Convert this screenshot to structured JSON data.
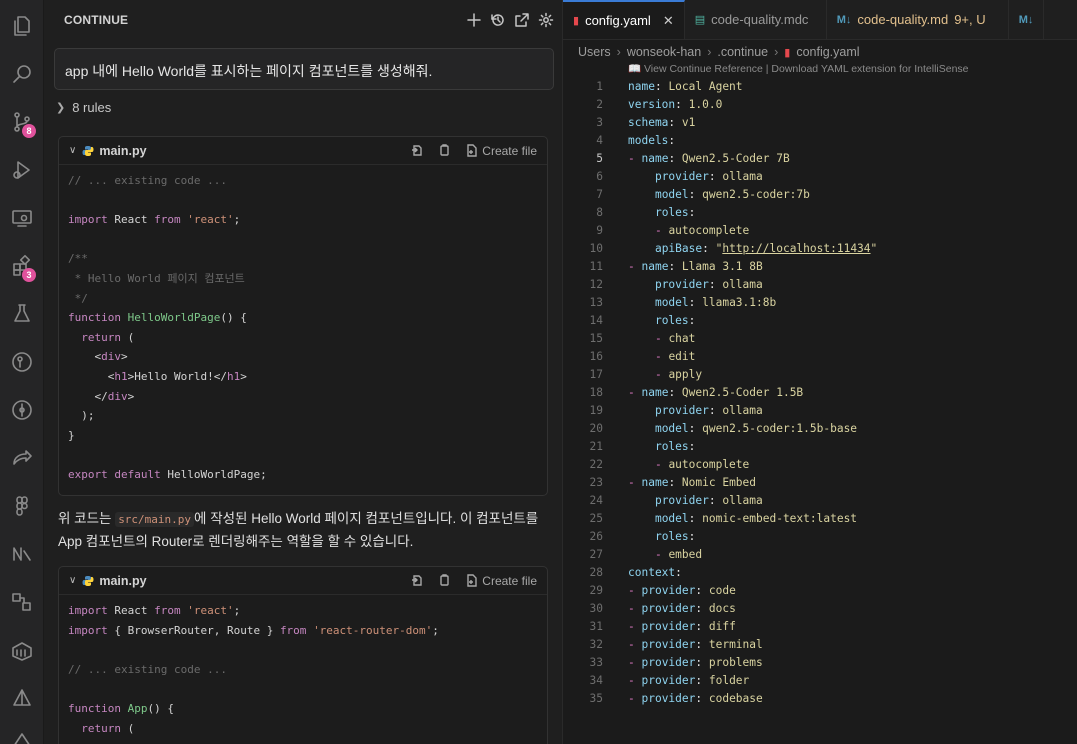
{
  "activity_bar": {
    "items": [
      {
        "name": "explorer-icon",
        "badge": ""
      },
      {
        "name": "search-icon",
        "badge": ""
      },
      {
        "name": "source-control-icon",
        "badge": "8"
      },
      {
        "name": "run-debug-icon",
        "badge": ""
      },
      {
        "name": "remote-explorer-icon",
        "badge": ""
      },
      {
        "name": "extensions-icon",
        "badge": "3"
      },
      {
        "name": "testing-icon",
        "badge": ""
      },
      {
        "name": "gitlens-icon",
        "badge": ""
      },
      {
        "name": "git-graph-icon",
        "badge": ""
      },
      {
        "name": "live-share-icon",
        "badge": ""
      },
      {
        "name": "figma-icon",
        "badge": ""
      },
      {
        "name": "n8n-icon",
        "badge": ""
      },
      {
        "name": "database-icon",
        "badge": ""
      },
      {
        "name": "docker-icon",
        "badge": ""
      },
      {
        "name": "prompt-icon",
        "badge": ""
      },
      {
        "name": "continue-icon",
        "badge": ""
      }
    ]
  },
  "panel": {
    "title": "CONTINUE",
    "prompt": "app 내에 Hello World를 표시하는 페이지 컴포넌트를 생성해줘.",
    "rules_label": "8 rules",
    "code_blocks": [
      {
        "filename": "main.py",
        "create_label": "Create file",
        "lines": [
          "// ... existing code ...",
          "",
          "import React from 'react';",
          "",
          "/**",
          " * Hello World 페이지 컴포넌트",
          " */",
          "function HelloWorldPage() {",
          "  return (",
          "    <div>",
          "      <h1>Hello World!</h1>",
          "    </div>",
          "  );",
          "}",
          "",
          "export default HelloWorldPage;"
        ]
      },
      {
        "filename": "main.py",
        "create_label": "Create file",
        "lines": [
          "import React from 'react';",
          "import { BrowserRouter, Route } from 'react-router-dom';",
          "",
          "// ... existing code ...",
          "",
          "function App() {",
          "  return ("
        ]
      }
    ],
    "explanation_pre": "위 코드는 ",
    "explanation_code": "src/main.py",
    "explanation_post": "에 작성된 Hello World 페이지 컴포넌트입니다. 이 컴포넌트를 App 컴포넌트의 Router로 렌더링해주는 역할을 할 수 있습니다."
  },
  "editor": {
    "tabs": [
      {
        "label": "config.yaml",
        "icon": "!",
        "active": true,
        "status": ""
      },
      {
        "label": "code-quality.mdc",
        "icon": "≡",
        "active": false,
        "status": ""
      },
      {
        "label": "code-quality.md",
        "icon": "M↓",
        "active": false,
        "status": "9+, U"
      },
      {
        "label": "",
        "icon": "M↓",
        "active": false,
        "status": ""
      }
    ],
    "breadcrumb": [
      "Users",
      "wonseok-han",
      ".continue",
      "config.yaml"
    ],
    "hint": "📖 View Continue Reference | Download YAML extension for IntelliSense",
    "current_line": 5,
    "lines": [
      {
        "n": "1",
        "indent": 0,
        "dash": false,
        "key": "name",
        "val": "Local Agent"
      },
      {
        "n": "2",
        "indent": 0,
        "dash": false,
        "key": "version",
        "val": "1.0.0"
      },
      {
        "n": "3",
        "indent": 0,
        "dash": false,
        "key": "schema",
        "val": "v1"
      },
      {
        "n": "4",
        "indent": 0,
        "dash": false,
        "key": "models",
        "val": ""
      },
      {
        "n": "5",
        "indent": 1,
        "dash": true,
        "key": "name",
        "val": "Qwen2.5-Coder 7B"
      },
      {
        "n": "6",
        "indent": 2,
        "dash": false,
        "key": "provider",
        "val": "ollama"
      },
      {
        "n": "7",
        "indent": 2,
        "dash": false,
        "key": "model",
        "val": "qwen2.5-coder:7b"
      },
      {
        "n": "8",
        "indent": 2,
        "dash": false,
        "key": "roles",
        "val": ""
      },
      {
        "n": "9",
        "indent": 3,
        "dash": true,
        "key": "",
        "val": "autocomplete"
      },
      {
        "n": "10",
        "indent": 2,
        "dash": false,
        "key": "apiBase",
        "val": "\"http://localhost:11434\""
      },
      {
        "n": "11",
        "indent": 1,
        "dash": true,
        "key": "name",
        "val": "Llama 3.1 8B"
      },
      {
        "n": "12",
        "indent": 2,
        "dash": false,
        "key": "provider",
        "val": "ollama"
      },
      {
        "n": "13",
        "indent": 2,
        "dash": false,
        "key": "model",
        "val": "llama3.1:8b"
      },
      {
        "n": "14",
        "indent": 2,
        "dash": false,
        "key": "roles",
        "val": ""
      },
      {
        "n": "15",
        "indent": 3,
        "dash": true,
        "key": "",
        "val": "chat"
      },
      {
        "n": "16",
        "indent": 3,
        "dash": true,
        "key": "",
        "val": "edit"
      },
      {
        "n": "17",
        "indent": 3,
        "dash": true,
        "key": "",
        "val": "apply"
      },
      {
        "n": "18",
        "indent": 1,
        "dash": true,
        "key": "name",
        "val": "Qwen2.5-Coder 1.5B"
      },
      {
        "n": "19",
        "indent": 2,
        "dash": false,
        "key": "provider",
        "val": "ollama"
      },
      {
        "n": "20",
        "indent": 2,
        "dash": false,
        "key": "model",
        "val": "qwen2.5-coder:1.5b-base"
      },
      {
        "n": "21",
        "indent": 2,
        "dash": false,
        "key": "roles",
        "val": ""
      },
      {
        "n": "22",
        "indent": 3,
        "dash": true,
        "key": "",
        "val": "autocomplete"
      },
      {
        "n": "23",
        "indent": 1,
        "dash": true,
        "key": "name",
        "val": "Nomic Embed"
      },
      {
        "n": "24",
        "indent": 2,
        "dash": false,
        "key": "provider",
        "val": "ollama"
      },
      {
        "n": "25",
        "indent": 2,
        "dash": false,
        "key": "model",
        "val": "nomic-embed-text:latest"
      },
      {
        "n": "26",
        "indent": 2,
        "dash": false,
        "key": "roles",
        "val": ""
      },
      {
        "n": "27",
        "indent": 3,
        "dash": true,
        "key": "",
        "val": "embed"
      },
      {
        "n": "28",
        "indent": 0,
        "dash": false,
        "key": "context",
        "val": ""
      },
      {
        "n": "29",
        "indent": 1,
        "dash": true,
        "key": "provider",
        "val": "code"
      },
      {
        "n": "30",
        "indent": 1,
        "dash": true,
        "key": "provider",
        "val": "docs"
      },
      {
        "n": "31",
        "indent": 1,
        "dash": true,
        "key": "provider",
        "val": "diff"
      },
      {
        "n": "32",
        "indent": 1,
        "dash": true,
        "key": "provider",
        "val": "terminal"
      },
      {
        "n": "33",
        "indent": 1,
        "dash": true,
        "key": "provider",
        "val": "problems"
      },
      {
        "n": "34",
        "indent": 1,
        "dash": true,
        "key": "provider",
        "val": "folder"
      },
      {
        "n": "35",
        "indent": 1,
        "dash": true,
        "key": "provider",
        "val": "codebase"
      }
    ]
  }
}
